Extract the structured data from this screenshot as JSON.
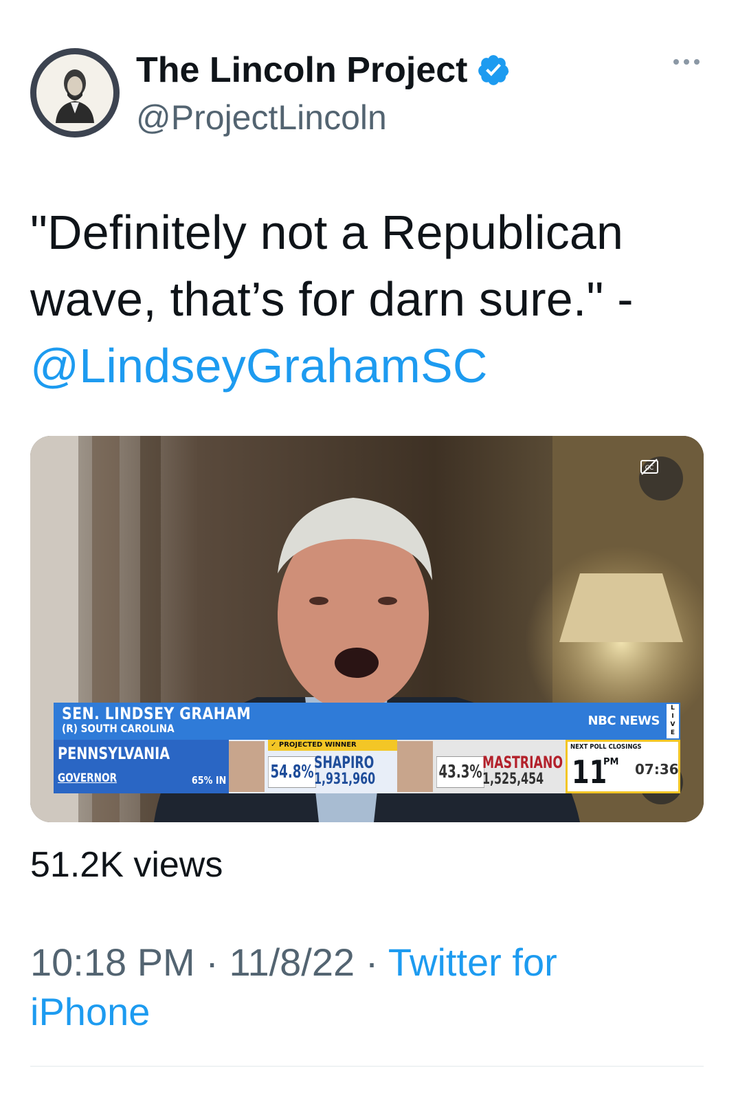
{
  "author": {
    "name": "The Lincoln Project",
    "handle": "@ProjectLincoln",
    "verified": true,
    "avatar_icon": "lincoln-portrait-icon"
  },
  "tweet": {
    "text": "\"Definitely not a Republican wave, that’s for darn sure.\" - ",
    "mention": "@LindseyGrahamSC"
  },
  "video": {
    "lower_third": {
      "speaker": "SEN. LINDSEY GRAHAM",
      "speaker_sub": "(R) SOUTH CAROLINA",
      "network": "NBC NEWS",
      "live": "LIVE",
      "state": "PENNSYLVANIA",
      "office": "GOVERNOR",
      "reporting": "65% IN",
      "winner_tag": "✓ PROJECTED WINNER",
      "candidate1": {
        "name": "SHAPIRO",
        "share": "54.8%",
        "votes": "1,931,960"
      },
      "candidate2": {
        "name": "MASTRIANO",
        "share": "43.3%",
        "votes": "1,525,454"
      },
      "poll_label": "NEXT POLL CLOSINGS",
      "poll_hour": "11",
      "poll_ampm": "PM",
      "poll_time": "07:36"
    },
    "captions_icon": "closed-captions-icon",
    "mute_icon": "muted-speaker-icon"
  },
  "stats": {
    "views": "51.2K views"
  },
  "meta": {
    "time": "10:18 PM",
    "sep1": " · ",
    "date": "11/8/22",
    "sep2": " · ",
    "source": "Twitter for iPhone"
  },
  "colors": {
    "link": "#1d9bf0",
    "secondary_text": "#536471",
    "verified": "#1d9bf0",
    "banner_blue": "#2f7bd8",
    "winner_yellow": "#f3c626"
  }
}
